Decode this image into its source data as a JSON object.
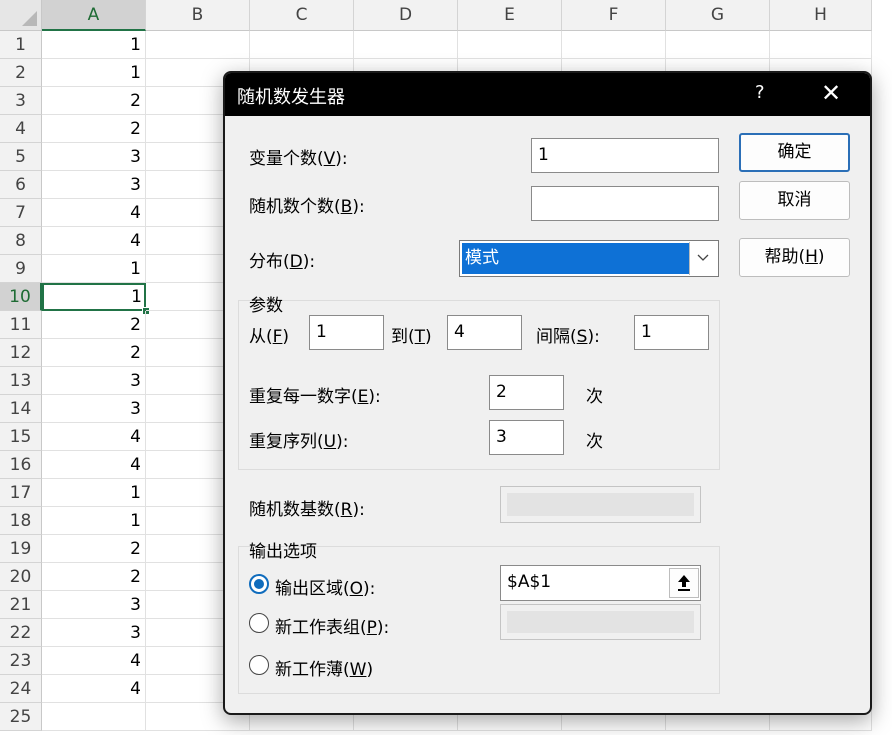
{
  "spreadsheet": {
    "columns": [
      "A",
      "B",
      "C",
      "D",
      "E",
      "F",
      "G",
      "H"
    ],
    "rows": [
      "1",
      "2",
      "3",
      "4",
      "5",
      "6",
      "7",
      "8",
      "9",
      "10",
      "11",
      "12",
      "13",
      "14",
      "15",
      "16",
      "17",
      "18",
      "19",
      "20",
      "21",
      "22",
      "23",
      "24",
      "25"
    ],
    "column_a_values": [
      "1",
      "1",
      "2",
      "2",
      "3",
      "3",
      "4",
      "4",
      "1",
      "1",
      "2",
      "2",
      "3",
      "3",
      "4",
      "4",
      "1",
      "1",
      "2",
      "2",
      "3",
      "3",
      "4",
      "4",
      ""
    ],
    "active_cell": "A10"
  },
  "dialog": {
    "title": "随机数发生器",
    "help_glyph": "?",
    "close_glyph": "✕",
    "num_variables": {
      "label": "变量个数(",
      "key": "V",
      "suffix": "):",
      "value": "1"
    },
    "num_random": {
      "label": "随机数个数(",
      "key": "B",
      "suffix": "):",
      "value": ""
    },
    "distribution": {
      "label": "分布(",
      "key": "D",
      "suffix": "):",
      "selected": "模式"
    },
    "parameters": {
      "group_label": "参数",
      "from": {
        "label": "从(",
        "key": "F",
        "suffix": ")",
        "value": "1"
      },
      "to": {
        "label": "到(",
        "key": "T",
        "suffix": ")",
        "value": "4"
      },
      "step": {
        "label": "间隔(",
        "key": "S",
        "suffix": "):",
        "value": "1"
      },
      "repeat_each": {
        "label": "重复每一数字(",
        "key": "E",
        "suffix": "):",
        "value": "2",
        "unit": "次"
      },
      "repeat_seq": {
        "label": "重复序列(",
        "key": "U",
        "suffix": "):",
        "value": "3",
        "unit": "次"
      }
    },
    "random_seed": {
      "label": "随机数基数(",
      "key": "R",
      "suffix": "):",
      "value": ""
    },
    "output": {
      "group_label": "输出选项",
      "output_range": {
        "label": "输出区域(",
        "key": "O",
        "suffix": "):",
        "value": "$A$1",
        "checked": true
      },
      "new_sheet": {
        "label": "新工作表组(",
        "key": "P",
        "suffix": "):",
        "value": "",
        "checked": false
      },
      "new_workbook": {
        "label": "新工作薄(",
        "key": "W",
        "suffix": ")",
        "checked": false
      }
    },
    "buttons": {
      "ok": "确定",
      "cancel": "取消",
      "help_label": "帮助(",
      "help_key": "H",
      "help_suffix": ")"
    }
  },
  "colors": {
    "accent": "#217346",
    "selection": "#0e71d6",
    "radio": "#0f6cbd"
  }
}
